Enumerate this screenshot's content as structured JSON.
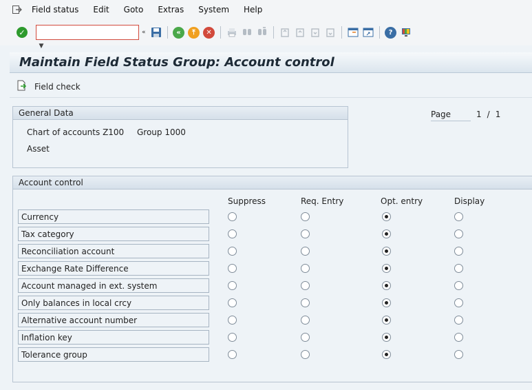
{
  "menubar": {
    "items": [
      "Field status",
      "Edit",
      "Goto",
      "Extras",
      "System",
      "Help"
    ]
  },
  "toolbar": {
    "command_value": ""
  },
  "title": "Maintain Field Status Group: Account control",
  "app_toolbar": {
    "field_check_label": "Field check"
  },
  "general_data": {
    "header": "General Data",
    "chart_of_accounts_label": "Chart of accounts",
    "chart_of_accounts_value": "Z100",
    "group_label": "Group",
    "group_value": "1000",
    "description": "Asset"
  },
  "page_info": {
    "label": "Page",
    "current": "1",
    "separator": "/",
    "total": "1"
  },
  "account_control": {
    "header": "Account control",
    "columns": [
      "Suppress",
      "Req. Entry",
      "Opt. entry",
      "Display"
    ],
    "rows": [
      {
        "label": "Currency",
        "selected": "Opt. entry"
      },
      {
        "label": "Tax category",
        "selected": "Opt. entry"
      },
      {
        "label": "Reconciliation account",
        "selected": "Opt. entry"
      },
      {
        "label": "Exchange Rate Difference",
        "selected": "Opt. entry"
      },
      {
        "label": "Account managed in ext. system",
        "selected": "Opt. entry"
      },
      {
        "label": "Only balances in local crcy",
        "selected": "Opt. entry"
      },
      {
        "label": "Alternative account number",
        "selected": "Opt. entry"
      },
      {
        "label": "Inflation key",
        "selected": "Opt. entry"
      },
      {
        "label": "Tolerance group",
        "selected": "Opt. entry"
      }
    ]
  }
}
